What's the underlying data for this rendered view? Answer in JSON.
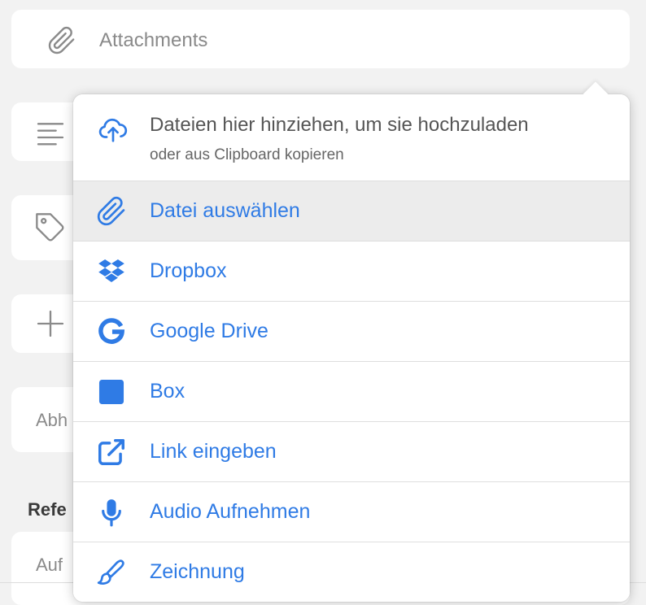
{
  "attachments": {
    "label": "Attachments",
    "icon": "paperclip-icon"
  },
  "background": {
    "description_icon": "lines-icon",
    "tags_icon": "tag-icon",
    "add_icon": "plus-icon",
    "abh_text": "Abh",
    "references_label": "Refe",
    "auf_text": "Auf"
  },
  "popover": {
    "upload": {
      "icon": "cloud-upload-icon",
      "title": "Dateien hier hinziehen, um sie hochzuladen",
      "subtitle": "oder aus Clipboard kopieren"
    },
    "items": [
      {
        "label": "Datei auswählen",
        "icon": "paperclip-icon",
        "active": true
      },
      {
        "label": "Dropbox",
        "icon": "dropbox-icon"
      },
      {
        "label": "Google Drive",
        "icon": "google-icon"
      },
      {
        "label": "Box",
        "icon": "box-icon"
      },
      {
        "label": "Link eingeben",
        "icon": "external-link-icon"
      },
      {
        "label": "Audio Aufnehmen",
        "icon": "microphone-icon"
      },
      {
        "label": "Zeichnung",
        "icon": "brush-icon"
      }
    ]
  },
  "colors": {
    "accent": "#2f7be5",
    "muted": "#8a8a8a",
    "background": "#f2f2f2"
  }
}
